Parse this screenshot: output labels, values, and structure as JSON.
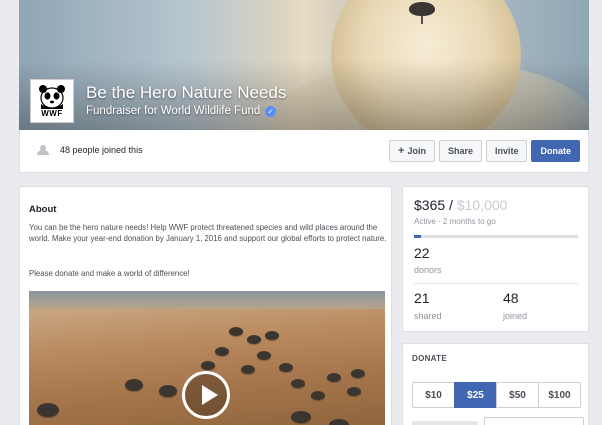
{
  "cover": {
    "title": "Be the Hero Nature Needs",
    "subtitle": "Fundraiser for World Wildlife Fund",
    "logo_text": "WWF"
  },
  "actionbar": {
    "joined_text": "48 people joined this",
    "buttons": {
      "join": "Join",
      "share": "Share",
      "invite": "Invite",
      "donate": "Donate"
    }
  },
  "about": {
    "heading": "About",
    "description": "You can be the hero nature needs! Help WWF protect threatened species and wild places around the world. Make your year-end donation by January 1, 2016 and support our global efforts to protect nature.",
    "call_to_action": "Please donate and make a world of difference!"
  },
  "stats": {
    "raised": "$365 / ",
    "goal": "$10,000",
    "status": "Active · 2 months to go",
    "progress_fraction": 0.0365,
    "donors_count": "22",
    "donors_label": "donors",
    "shared_count": "21",
    "shared_label": "shared",
    "joined_count": "48",
    "joined_label": "joined"
  },
  "donate": {
    "heading": "DONATE",
    "amounts": [
      "$10",
      "$25",
      "$50",
      "$100"
    ],
    "selected": "$25"
  },
  "colors": {
    "accent": "#4267b2",
    "background": "#e9ebee",
    "verified": "#5890ff"
  },
  "icons": [
    "panda-logo-icon",
    "verified-badge-icon",
    "people-icon",
    "plus-icon",
    "play-icon"
  ]
}
